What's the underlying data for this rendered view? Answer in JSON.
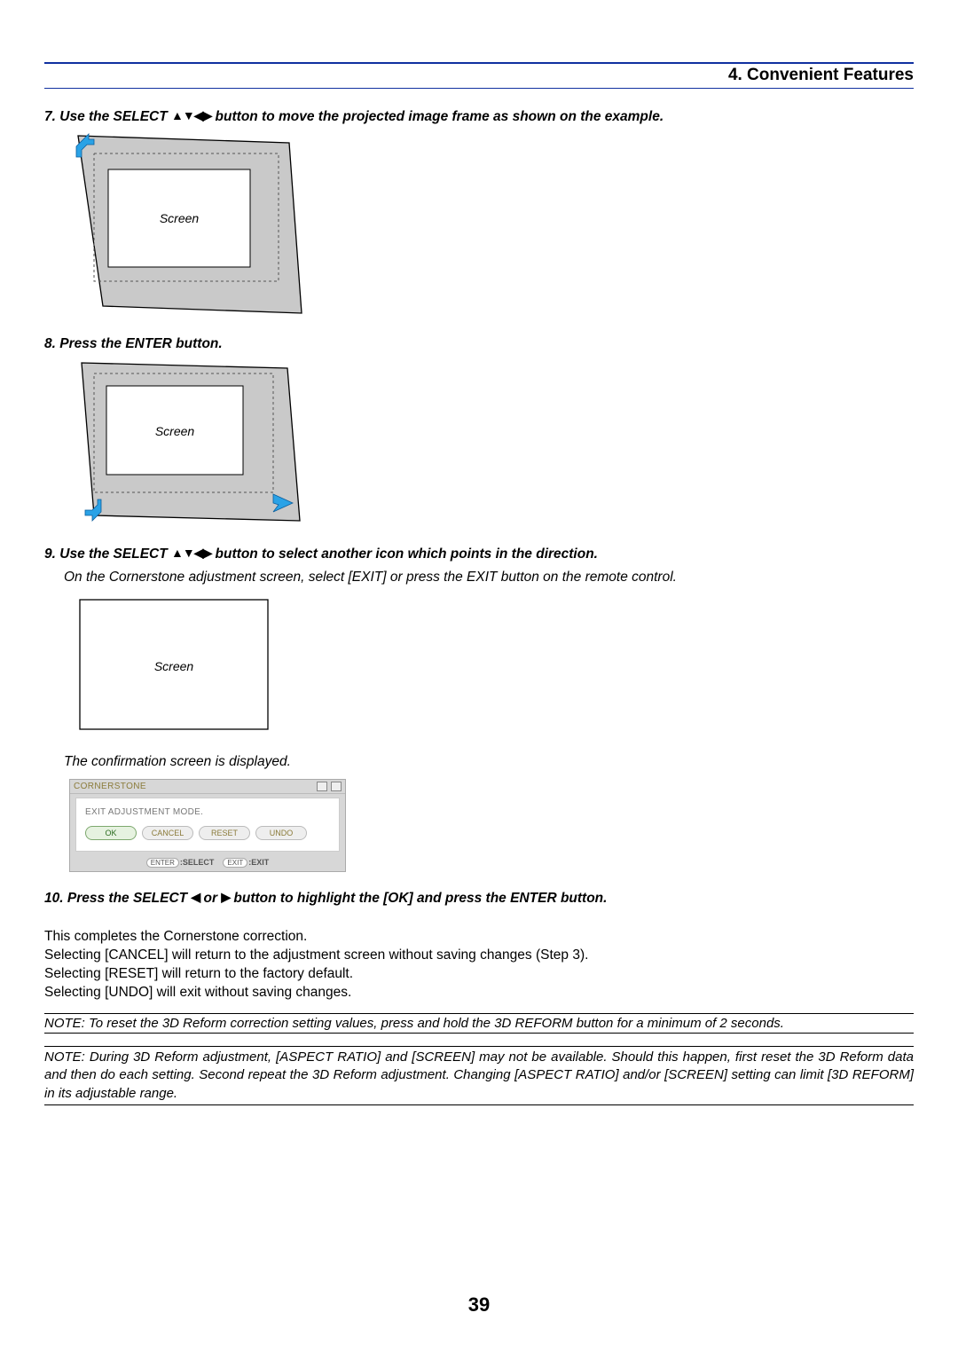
{
  "header": {
    "section_title": "4. Convenient Features"
  },
  "steps": {
    "s7": {
      "num": "7.",
      "prefix": "Use the SELECT ",
      "suffix": " button to move the projected image frame as shown on the example.",
      "screen_label": "Screen"
    },
    "s8": {
      "num": "8.",
      "text": "Press the ENTER button.",
      "screen_label": "Screen"
    },
    "s9": {
      "num": "9.",
      "prefix": "Use the SELECT ",
      "suffix": " button to select another icon which points in the direction.",
      "body": "On the Cornerstone adjustment screen, select [EXIT] or press the EXIT button on the remote control.",
      "screen_label": "Screen",
      "caption": "The confirmation screen is displayed."
    },
    "s10": {
      "num": "10.",
      "prefix": "Press the SELECT ",
      "mid": " or ",
      "suffix": " button to highlight the [OK] and press the ENTER button."
    }
  },
  "dialog": {
    "title": "CORNERSTONE",
    "message": "EXIT ADJUSTMENT MODE.",
    "buttons": {
      "ok": "OK",
      "cancel": "CANCEL",
      "reset": "RESET",
      "undo": "UNDO"
    },
    "footer": {
      "enter": "ENTER",
      "select": ":SELECT",
      "exit": "EXIT",
      "exit_label": ":EXIT"
    }
  },
  "closing": {
    "l1": "This completes the Cornerstone correction.",
    "l2": "Selecting [CANCEL] will return to the adjustment screen without saving changes (Step 3).",
    "l3": "Selecting [RESET] will return to the factory default.",
    "l4": "Selecting [UNDO] will exit without saving changes."
  },
  "notes": {
    "n1": "NOTE: To reset the 3D Reform correction setting values, press and hold the 3D REFORM button for a minimum of 2 seconds.",
    "n2": "NOTE: During 3D Reform adjustment, [ASPECT RATIO] and [SCREEN] may not be available. Should this happen, first reset the 3D Reform data and then do each setting. Second repeat the 3D Reform adjustment. Changing [ASPECT RATIO] and/or [SCREEN] setting can limit [3D REFORM] in its adjustable range."
  },
  "page_number": "39",
  "icons": {
    "udlr": "▲▼◀▶",
    "left": "◀",
    "right": "▶"
  }
}
